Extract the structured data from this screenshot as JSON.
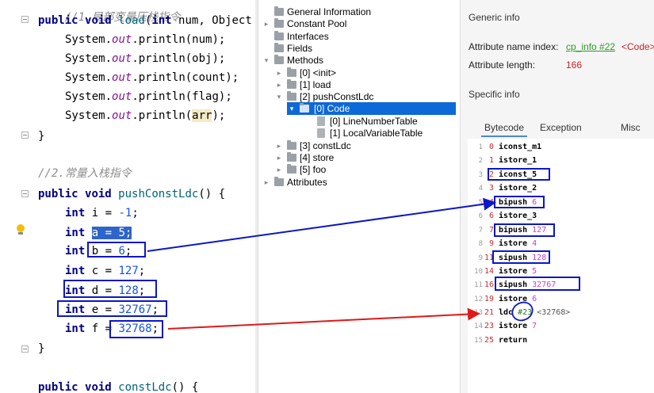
{
  "editor": {
    "lines": [
      {
        "t": "top_comment",
        "text": "//1.局部变量压栈指令"
      },
      {
        "t": "load_sig",
        "kw1": "public",
        "kw2": "void",
        "fn": "load",
        "rest_a": "(",
        "kw3": "int",
        "rest_b": " num, Object"
      },
      {
        "t": "println",
        "pre": "System.",
        "field": "out",
        "mid": ".println(",
        "arg": "num",
        "post": ");"
      },
      {
        "t": "println",
        "pre": "System.",
        "field": "out",
        "mid": ".println(",
        "arg": "obj",
        "post": ");"
      },
      {
        "t": "println",
        "pre": "System.",
        "field": "out",
        "mid": ".println(",
        "arg": "count",
        "post": ");"
      },
      {
        "t": "println",
        "pre": "System.",
        "field": "out",
        "mid": ".println(",
        "arg": "flag",
        "post": ");"
      },
      {
        "t": "println",
        "pre": "System.",
        "field": "out",
        "mid": ".println(",
        "arg": "arr",
        "post": ");"
      },
      {
        "t": "brace",
        "text": "}"
      },
      {
        "t": "comment",
        "text": "//2.常量入栈指令"
      },
      {
        "t": "method_sig",
        "kw1": "public",
        "kw2": "void",
        "fn": "pushConstLdc",
        "rest": "() {"
      },
      {
        "t": "decl",
        "kw": "int",
        "name": "i",
        "op": " = ",
        "val": "-1",
        "end": ";"
      },
      {
        "t": "decl_sel",
        "kw": "int",
        "sel": "a = 5;"
      },
      {
        "t": "decl",
        "kw": "int",
        "name": "b",
        "op": " = ",
        "val": "6",
        "end": ";"
      },
      {
        "t": "decl",
        "kw": "int",
        "name": "c",
        "op": " = ",
        "val": "127",
        "end": ";"
      },
      {
        "t": "decl",
        "kw": "int",
        "name": "d",
        "op": " = ",
        "val": "128",
        "end": ";"
      },
      {
        "t": "decl",
        "kw": "int",
        "name": "e",
        "op": " = ",
        "val": "32767",
        "end": ";"
      },
      {
        "t": "decl",
        "kw": "int",
        "name": "f",
        "op": " = ",
        "val": "32768",
        "end": ";"
      },
      {
        "t": "brace",
        "text": "}"
      },
      {
        "t": "method_sig",
        "kw1": "public",
        "kw2": "void",
        "fn": "constLdc",
        "rest": "() {"
      }
    ]
  },
  "tree": {
    "items": [
      {
        "label": "General Information",
        "icon": "folder-icon",
        "expand": ""
      },
      {
        "label": "Constant Pool",
        "icon": "folder-icon",
        "expand": ">"
      },
      {
        "label": "Interfaces",
        "icon": "folder-icon",
        "expand": ""
      },
      {
        "label": "Fields",
        "icon": "folder-icon",
        "expand": ""
      },
      {
        "label": "Methods",
        "icon": "folder-icon",
        "expand": "v"
      },
      {
        "label": "[0] <init>",
        "icon": "folder-icon",
        "expand": ">"
      },
      {
        "label": "[1] load",
        "icon": "folder-icon",
        "expand": ">"
      },
      {
        "label": "[2] pushConstLdc",
        "icon": "folder-icon",
        "expand": "v"
      },
      {
        "label": "[0] Code",
        "icon": "folder-icon",
        "expand": "v",
        "selected": true
      },
      {
        "label": "[0] LineNumberTable",
        "icon": "file-icon",
        "expand": ""
      },
      {
        "label": "[1] LocalVariableTable",
        "icon": "file-icon",
        "expand": ""
      },
      {
        "label": "[3] constLdc",
        "icon": "folder-icon",
        "expand": ">"
      },
      {
        "label": "[4] store",
        "icon": "folder-icon",
        "expand": ">"
      },
      {
        "label": "[5] foo",
        "icon": "folder-icon",
        "expand": ">"
      },
      {
        "label": "Attributes",
        "icon": "folder-icon",
        "expand": ">"
      }
    ]
  },
  "info": {
    "generic_title": "Generic info",
    "attr_name_label": "Attribute name index:",
    "attr_name_link": "cp_info #22",
    "attr_name_value": "<Code>",
    "attr_len_label": "Attribute length:",
    "attr_len_value": "166",
    "specific_title": "Specific info",
    "tabs": [
      "Bytecode",
      "Exception table",
      "Misc"
    ]
  },
  "bytecode": [
    {
      "ln": "1",
      "off": "0",
      "op": "iconst_m1",
      "arg": ""
    },
    {
      "ln": "2",
      "off": "1",
      "op": "istore_1",
      "arg": ""
    },
    {
      "ln": "3",
      "off": "2",
      "op": "iconst_5",
      "arg": ""
    },
    {
      "ln": "4",
      "off": "3",
      "op": "istore_2",
      "arg": ""
    },
    {
      "ln": "5",
      "off": "4",
      "op": "bipush",
      "arg": "6"
    },
    {
      "ln": "6",
      "off": "6",
      "op": "istore_3",
      "arg": ""
    },
    {
      "ln": "7",
      "off": "7",
      "op": "bipush",
      "arg": "127"
    },
    {
      "ln": "8",
      "off": "9",
      "op": "istore",
      "arg": "4"
    },
    {
      "ln": "9",
      "off": "11",
      "op": "sipush",
      "arg": "128"
    },
    {
      "ln": "10",
      "off": "14",
      "op": "istore",
      "arg": "5"
    },
    {
      "ln": "11",
      "off": "16",
      "op": "sipush",
      "arg": "32767"
    },
    {
      "ln": "12",
      "off": "19",
      "op": "istore",
      "arg": "6"
    },
    {
      "ln": "13",
      "off": "21",
      "op": "ldc",
      "arg": "#23",
      "ref": "<32768>"
    },
    {
      "ln": "14",
      "off": "23",
      "op": "istore",
      "arg": "7"
    },
    {
      "ln": "15",
      "off": "25",
      "op": "return",
      "arg": ""
    }
  ],
  "colors": {
    "annotation_blue": "#0b16c8",
    "annotation_red": "#e01818",
    "selection": "#0d68d8"
  }
}
